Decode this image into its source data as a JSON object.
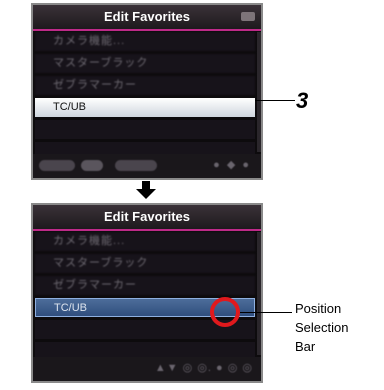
{
  "screen1": {
    "title": "Edit Favorites",
    "rows": [
      "カメラ機能...",
      "マスターブラック",
      "ゼブラマーカー",
      "TC/UB",
      "",
      ""
    ],
    "footer_dots": "● ◆ ●"
  },
  "screen2": {
    "title": "Edit Favorites",
    "rows": [
      "カメラ機能...",
      "マスターブラック",
      "ゼブラマーカー",
      "TC/UB",
      "",
      ""
    ],
    "footer_text": "▲▼ ◎ ◎. ● ◎ ◎"
  },
  "callout": {
    "number": "3"
  },
  "position_label": [
    "Position",
    "Selection",
    "Bar"
  ],
  "colors": {
    "title_accent": "#c02a8a",
    "selected_row_1": "#e8ecf0",
    "selected_row_2": "#3d5d8c",
    "highlight_circle": "#e0191d"
  }
}
